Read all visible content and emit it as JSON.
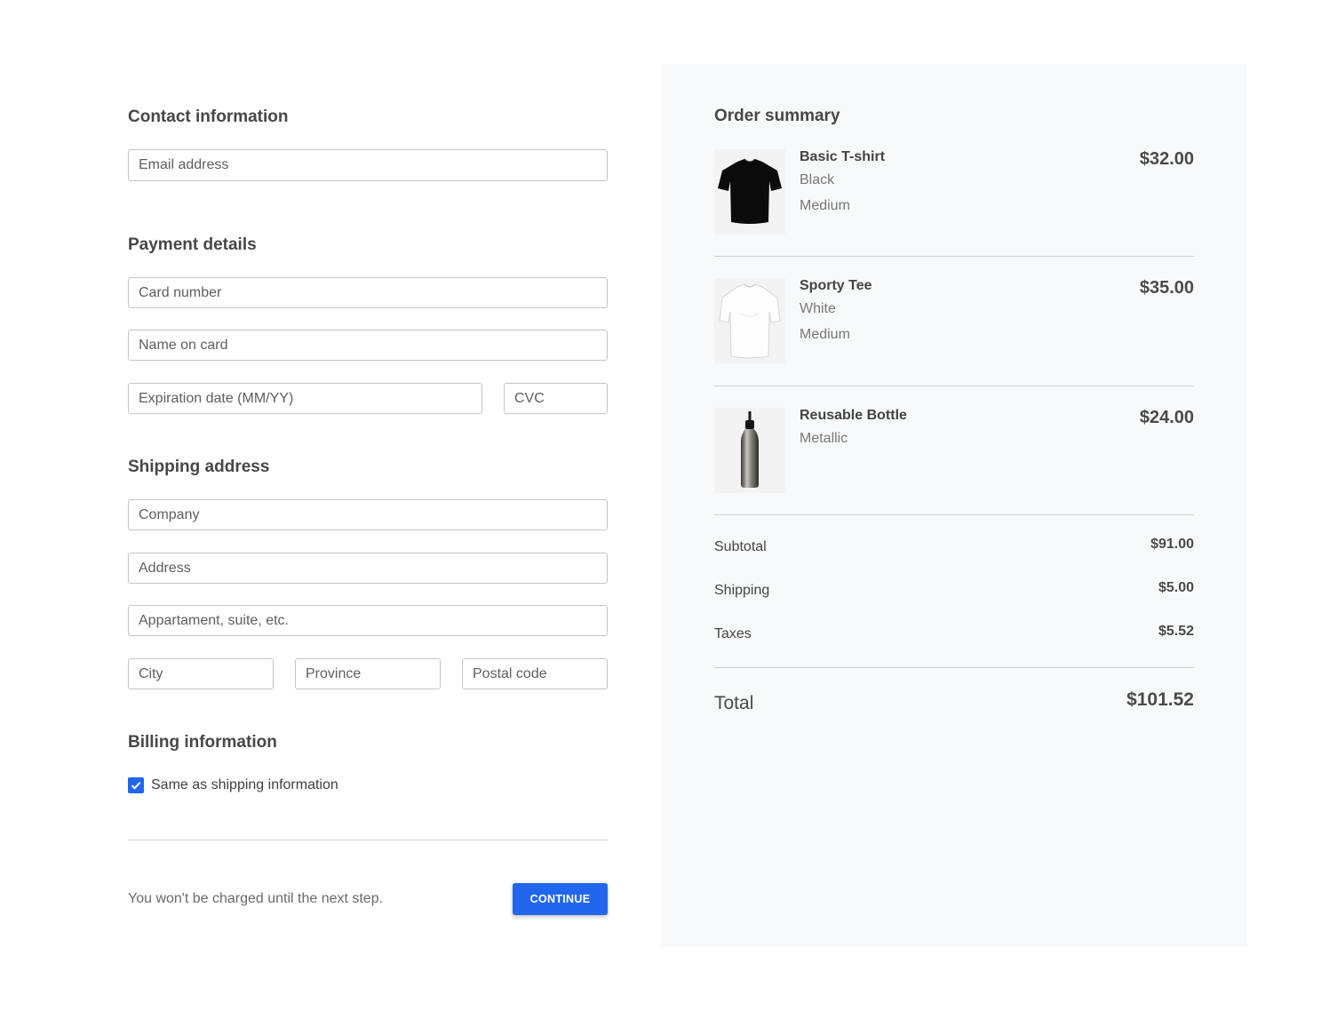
{
  "contact": {
    "title": "Contact information",
    "email_placeholder": "Email address"
  },
  "payment": {
    "title": "Payment details",
    "card_number_placeholder": "Card number",
    "name_on_card_placeholder": "Name on card",
    "expiration_placeholder": "Expiration date (MM/YY)",
    "cvc_placeholder": "CVC"
  },
  "shipping": {
    "title": "Shipping address",
    "company_placeholder": "Company",
    "address_placeholder": "Address",
    "apartment_placeholder": "Appartament, suite, etc.",
    "city_placeholder": "City",
    "province_placeholder": "Province",
    "postal_placeholder": "Postal code"
  },
  "billing": {
    "title": "Billing information",
    "same_as_shipping_label": "Same as shipping information",
    "same_as_shipping_checked": true
  },
  "footer": {
    "note": "You won't be charged until the next step.",
    "continue_label": "CONTINUE"
  },
  "summary": {
    "title": "Order summary",
    "items": [
      {
        "name": "Basic T-shirt",
        "variant": "Black",
        "size": "Medium",
        "price": "$32.00",
        "icon": "black-tshirt-icon"
      },
      {
        "name": "Sporty Tee",
        "variant": "White",
        "size": "Medium",
        "price": "$35.00",
        "icon": "white-tshirt-icon"
      },
      {
        "name": "Reusable Bottle",
        "variant": "Metallic",
        "price": "$24.00",
        "icon": "bottle-icon"
      }
    ],
    "subtotal_label": "Subtotal",
    "subtotal": "$91.00",
    "shipping_label": "Shipping",
    "shipping": "$5.00",
    "taxes_label": "Taxes",
    "taxes": "$5.52",
    "total_label": "Total",
    "total": "$101.52"
  },
  "colors": {
    "accent": "#2266ee",
    "summary_bg": "#f8f9fa"
  }
}
